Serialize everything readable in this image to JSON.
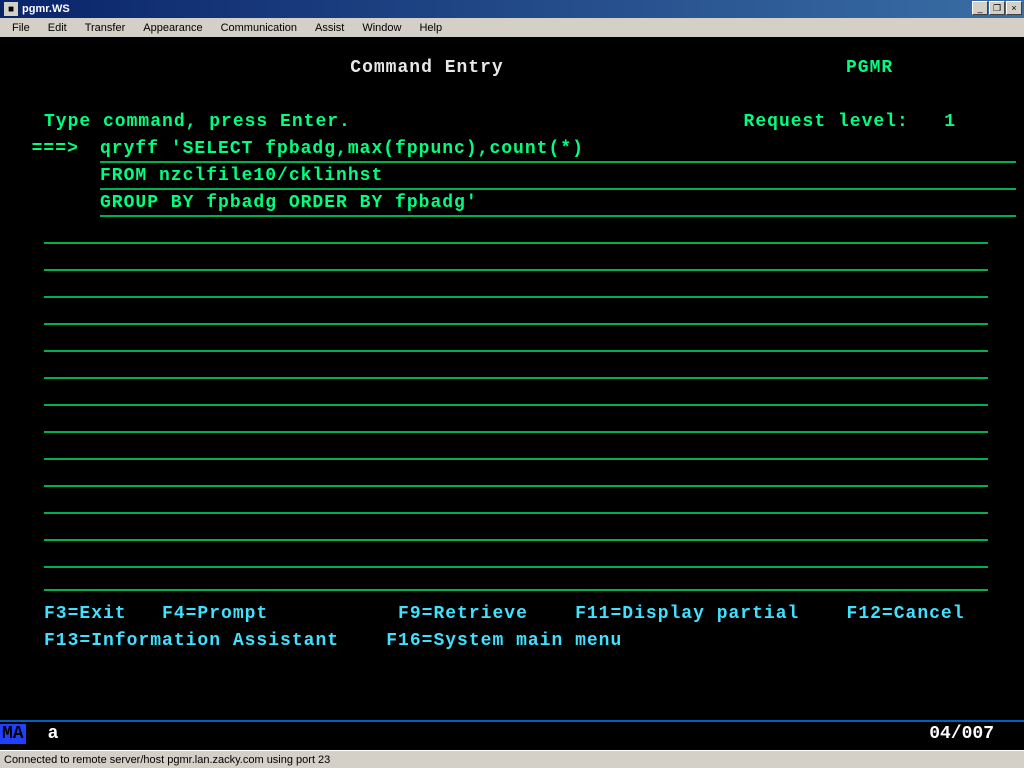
{
  "window": {
    "title": "pgmr.WS",
    "buttons": {
      "min": "_",
      "max": "❐",
      "close": "×"
    }
  },
  "menu": [
    "File",
    "Edit",
    "Transfer",
    "Appearance",
    "Communication",
    "Assist",
    "Window",
    "Help"
  ],
  "screen": {
    "title": "Command Entry",
    "user": "PGMR",
    "request_label": "Request level:",
    "request_level": "1",
    "instruction": "Type command, press Enter.",
    "prompt": "===>",
    "command_lines": [
      "qryff 'SELECT fpbadg,max(fppunc),count(*)",
      "FROM nzclfile10/cklinhst",
      "GROUP BY fpbadg ORDER BY fpbadg'"
    ],
    "blank_input_rows": 13,
    "fkeys_row1": "F3=Exit   F4=Prompt           F9=Retrieve    F11=Display partial    F12=Cancel",
    "fkeys_row2": "F13=Information Assistant    F16=System main menu"
  },
  "status": {
    "indicator": "MA",
    "mode": "a",
    "cursor": "04/007"
  },
  "app_status": "Connected to remote server/host pgmr.lan.zacky.com using port 23"
}
